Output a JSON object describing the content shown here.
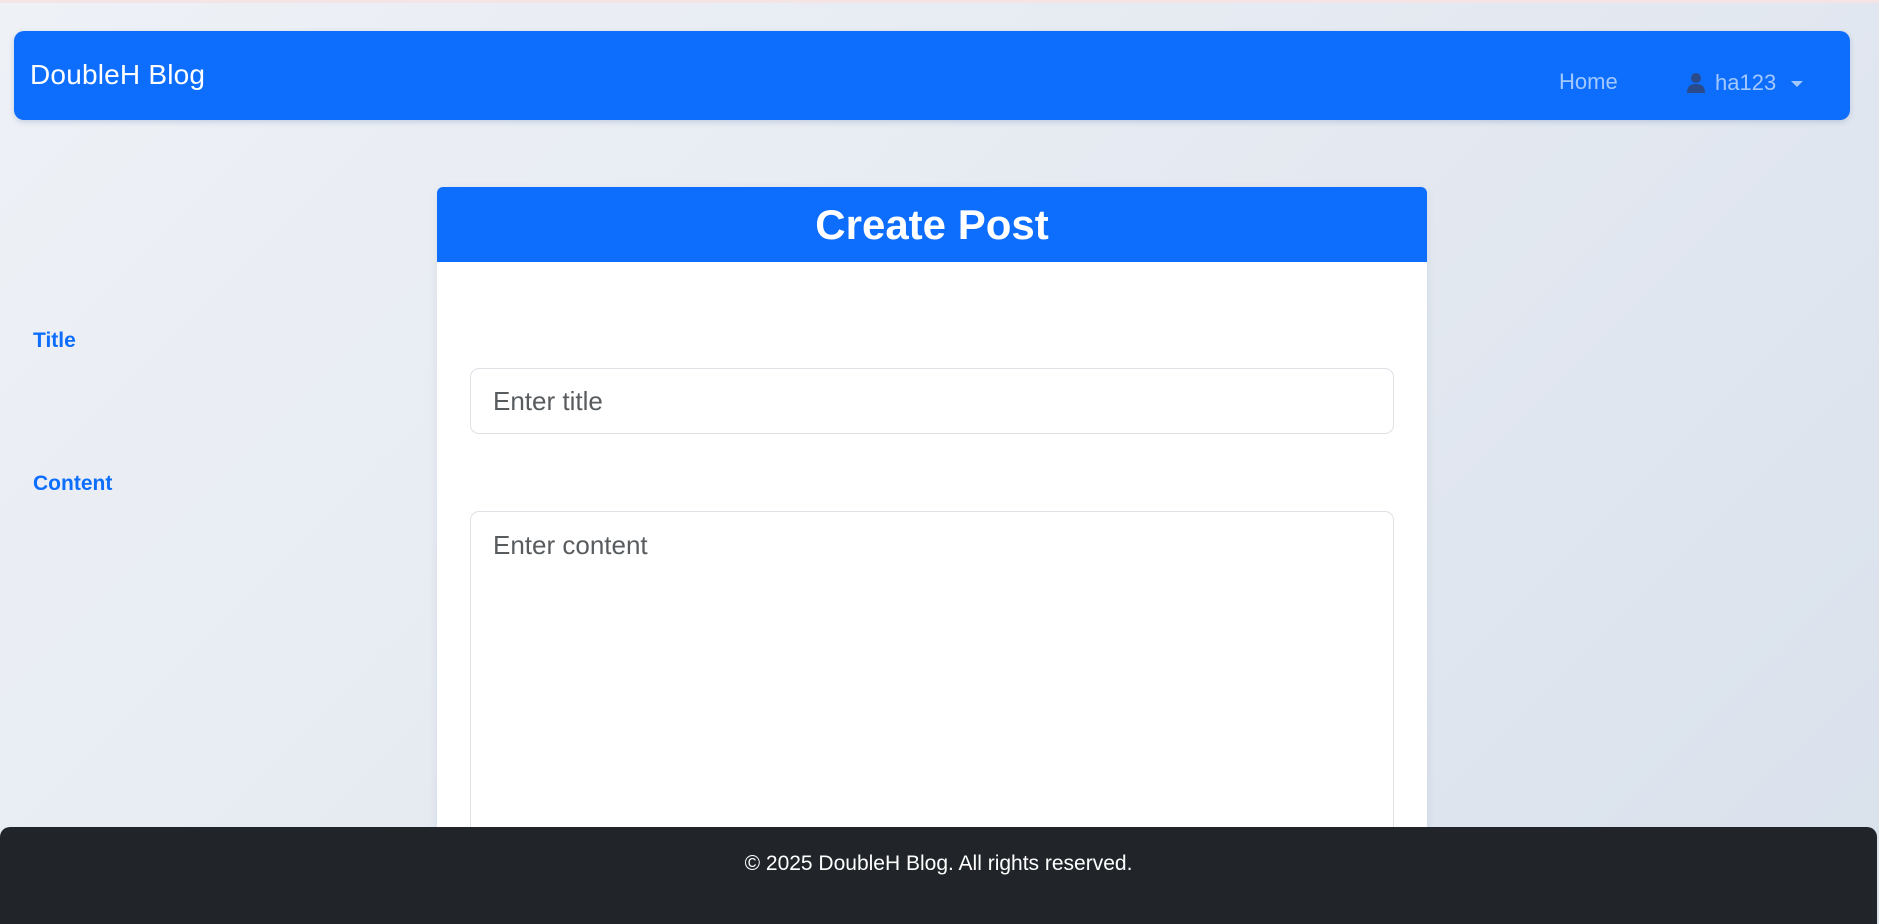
{
  "navbar": {
    "brand": "DoubleH Blog",
    "home_label": "Home",
    "username": "ha123",
    "user_icon": "person-icon"
  },
  "card": {
    "title": "Create Post",
    "title_label": "Title",
    "title_placeholder": "Enter title",
    "title_value": "",
    "content_label": "Content",
    "content_placeholder": "Enter content",
    "content_value": ""
  },
  "footer": {
    "text": "© 2025 DoubleH Blog. All rights reserved."
  },
  "colors": {
    "primary": "#0d6efd",
    "footer_bg": "#212529",
    "label": "#0d6efd"
  }
}
